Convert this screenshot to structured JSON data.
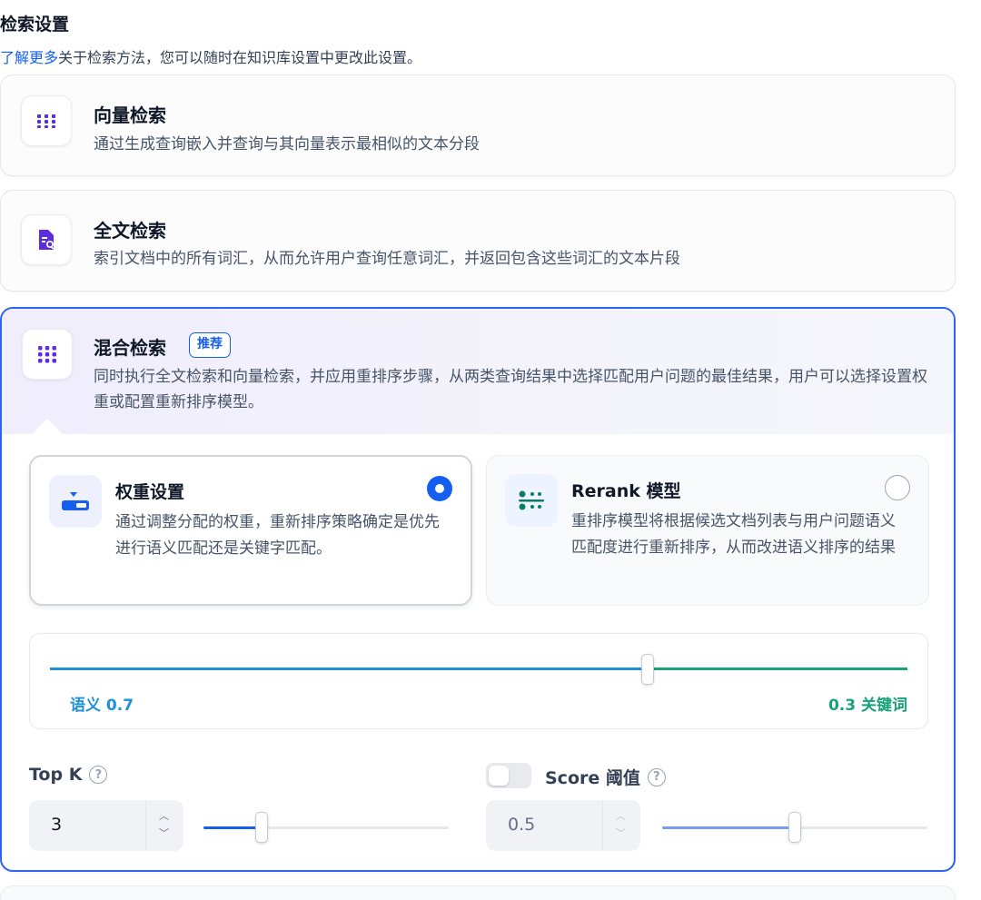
{
  "header": {
    "title": "检索设置",
    "learn_more": "了解更多",
    "subtitle_rest": "关于检索方法，您可以随时在知识库设置中更改此设置。"
  },
  "methods": {
    "vector": {
      "icon": "grid-dots-icon",
      "title": "向量检索",
      "desc": "通过生成查询嵌入并查询与其向量表示最相似的文本分段"
    },
    "fulltext": {
      "icon": "document-search-icon",
      "title": "全文检索",
      "desc": "索引文档中的所有词汇，从而允许用户查询任意词汇，并返回包含这些词汇的文本片段"
    },
    "hybrid": {
      "icon": "grid-dots-icon",
      "title": "混合检索",
      "badge": "推荐",
      "desc": "同时执行全文检索和向量检索，并应用重排序步骤，从两类查询结果中选择匹配用户问题的最佳结果，用户可以选择设置权重或配置重新排序模型。",
      "selected": true
    }
  },
  "hybrid_options": {
    "weight": {
      "title": "权重设置",
      "desc": "通过调整分配的权重，重新排序策略确定是优先进行语义匹配还是关键字匹配。",
      "selected": true
    },
    "rerank": {
      "title": "Rerank 模型",
      "desc": "重排序模型将根据候选文档列表与用户问题语义匹配度进行重新排序，从而改进语义排序的结果",
      "selected": false
    }
  },
  "weights": {
    "semantic_label": "语义 0.7",
    "keyword_label": "0.3 关键词",
    "semantic": 0.7,
    "keyword": 0.3,
    "semantic_color": "#1d91d9",
    "keyword_color": "#17a37a"
  },
  "top_k": {
    "label": "Top K",
    "help": "?",
    "value": "3",
    "slider_fraction": 0.26
  },
  "score_threshold": {
    "label": "Score 阈值",
    "help": "?",
    "enabled": false,
    "value": "0.5",
    "slider_fraction": 0.5
  },
  "colors": {
    "accent": "#155eef",
    "selected_border": "#2e62f0"
  }
}
